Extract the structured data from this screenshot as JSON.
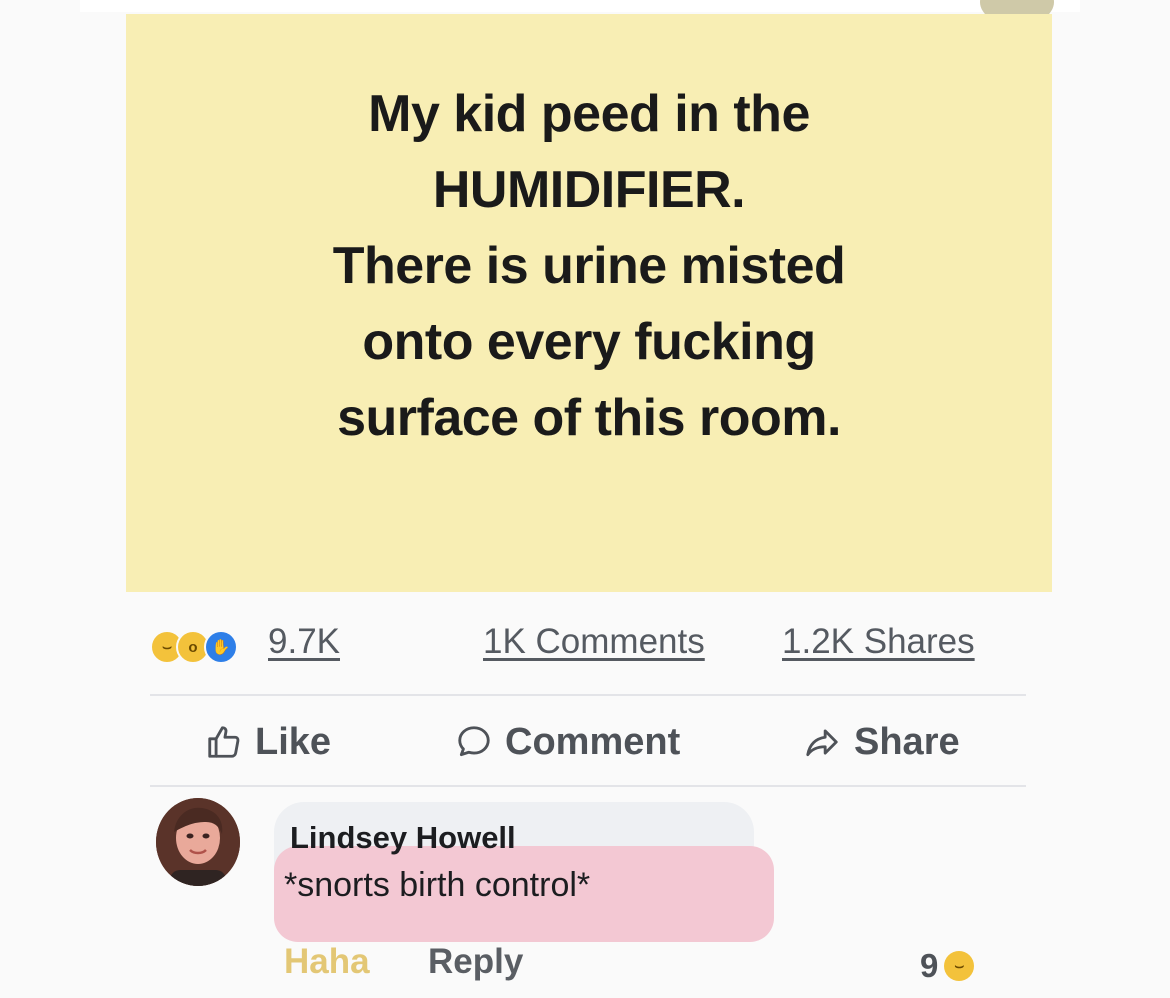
{
  "post": {
    "text_lines": [
      "My kid peed in the",
      "HUMIDIFIER.",
      "There is urine misted",
      "onto every fucking",
      "surface of this room."
    ],
    "background_color": "#f8eeb4"
  },
  "stats": {
    "reaction_icons": [
      "haha-icon",
      "wow-icon",
      "like-icon"
    ],
    "reaction_count": "9.7K",
    "comments": "1K Comments",
    "shares": "1.2K Shares"
  },
  "actions": {
    "like": "Like",
    "comment": "Comment",
    "share": "Share"
  },
  "comment": {
    "author": "Lindsey Howell",
    "text": "*snorts birth control*",
    "reaction_label": "Haha",
    "reply_label": "Reply",
    "reaction_count": "9"
  },
  "colors": {
    "accent_like": "#2e7fe8",
    "haha_yellow": "#f3c23b",
    "highlight_pink": "#f3c8d3"
  }
}
